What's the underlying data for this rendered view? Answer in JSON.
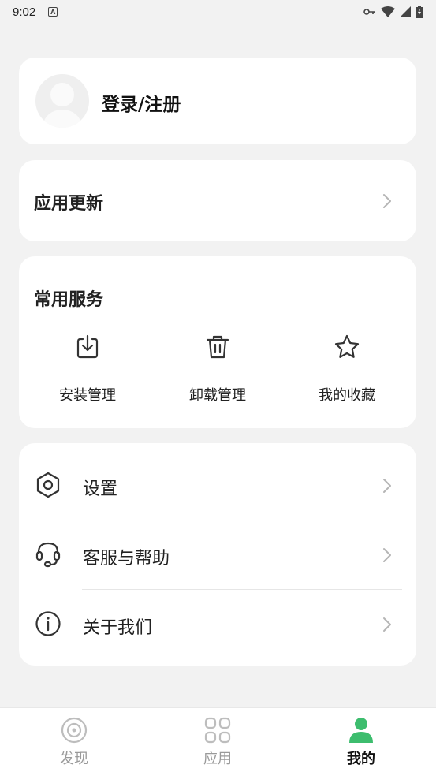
{
  "status_bar": {
    "time": "9:02",
    "notification_icon": "a-icon",
    "right_icons": [
      "key-icon",
      "wifi-icon",
      "signal-icon",
      "battery-icon"
    ]
  },
  "profile": {
    "login_label": "登录/注册",
    "avatar_icon": "default-avatar-icon"
  },
  "update": {
    "title": "应用更新"
  },
  "services": {
    "title": "常用服务",
    "items": [
      {
        "label": "安装管理",
        "icon": "install-icon"
      },
      {
        "label": "卸载管理",
        "icon": "trash-icon"
      },
      {
        "label": "我的收藏",
        "icon": "star-icon"
      }
    ]
  },
  "menu": {
    "items": [
      {
        "label": "设置",
        "icon": "settings-hexagon-icon"
      },
      {
        "label": "客服与帮助",
        "icon": "headset-icon"
      },
      {
        "label": "关于我们",
        "icon": "info-icon"
      }
    ]
  },
  "bottom_nav": {
    "items": [
      {
        "label": "发现",
        "icon": "discover-icon",
        "active": false
      },
      {
        "label": "应用",
        "icon": "apps-grid-icon",
        "active": false
      },
      {
        "label": "我的",
        "icon": "user-icon",
        "active": true
      }
    ]
  },
  "colors": {
    "accent": "#3dbd6e",
    "background": "#f2f2f2",
    "card": "#ffffff",
    "inactive": "#9a9a9a"
  }
}
